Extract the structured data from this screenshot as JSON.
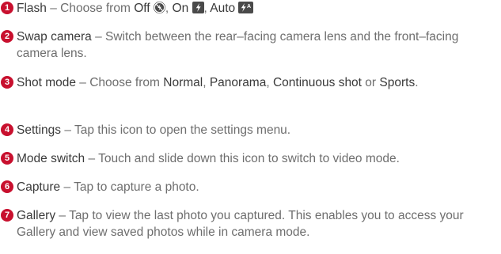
{
  "items": [
    {
      "num": "1",
      "term": "Flash",
      "desc": " – Choose from ",
      "opt1": "Off",
      "opt2": "On",
      "opt3": "Auto",
      "sep1": ", ",
      "sep2": ", ",
      "icon3_text": "A",
      "icons": [
        "flash-off-icon",
        "flash-on-icon",
        "flash-auto-icon"
      ]
    },
    {
      "num": "2",
      "term": "Swap camera",
      "desc": " – Switch between the rear–facing camera lens and the front–facing camera lens."
    },
    {
      "num": "3",
      "term": "Shot mode",
      "desc1": " – Choose from ",
      "opt1": "Normal",
      "sep1": ", ",
      "opt2": "Panorama",
      "sep2": ", ",
      "opt3": "Continuous shot",
      "sep3": " or ",
      "opt4": "Sports",
      "end": "."
    },
    {
      "num": "4",
      "term": "Settings",
      "desc": " – Tap this icon to open the settings menu."
    },
    {
      "num": "5",
      "term": "Mode switch",
      "desc": " – Touch and slide down this icon to switch to video mode."
    },
    {
      "num": "6",
      "term": "Capture",
      "desc": " – Tap to capture a photo."
    },
    {
      "num": "7",
      "term": "Gallery",
      "desc": " – Tap to view the last photo you captured. This enables you to access your Gallery and view saved photos while in camera mode."
    }
  ],
  "colors": {
    "badge": "#c8102e",
    "term": "#3a3a3a",
    "text": "#6e6e6e"
  }
}
